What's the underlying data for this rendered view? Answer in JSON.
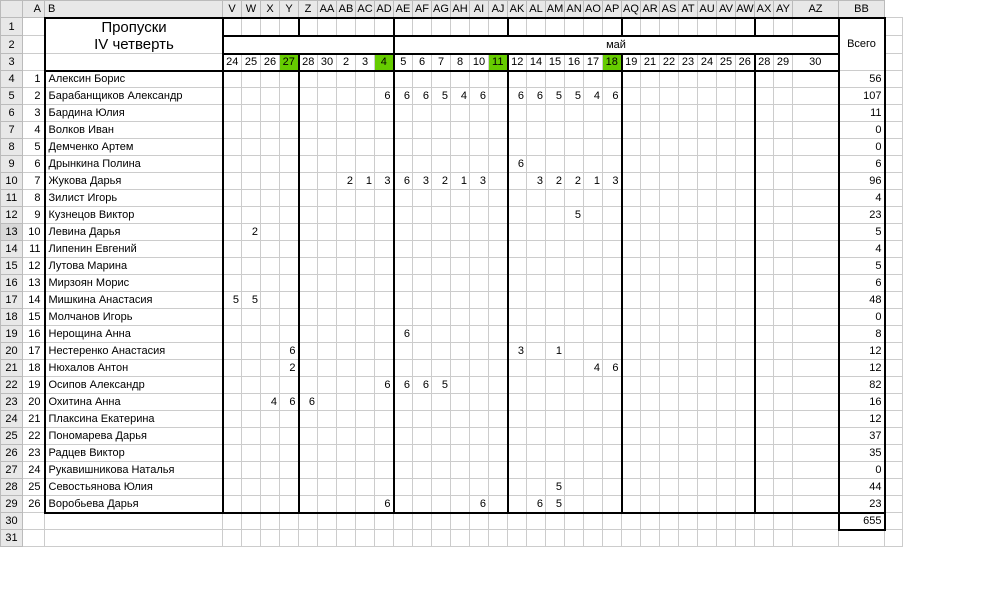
{
  "title_line1": "Пропуски",
  "title_line2": "IV четверть",
  "month_label": "май",
  "total_label": "Всего",
  "column_letters": [
    "A",
    "B",
    "V",
    "W",
    "X",
    "Y",
    "Z",
    "AA",
    "AB",
    "AC",
    "AD",
    "AE",
    "AF",
    "AG",
    "AH",
    "AI",
    "AJ",
    "AK",
    "AL",
    "AM",
    "AN",
    "AO",
    "AP",
    "AQ",
    "AR",
    "AS",
    "AT",
    "AU",
    "AV",
    "AW",
    "AX",
    "AY",
    "AZ",
    "BB"
  ],
  "row_numbers": [
    "1",
    "2",
    "3",
    "4",
    "5",
    "6",
    "7",
    "8",
    "9",
    "10",
    "11",
    "12",
    "13",
    "14",
    "15",
    "16",
    "17",
    "18",
    "19",
    "20",
    "21",
    "22",
    "23",
    "24",
    "25",
    "26",
    "27",
    "28",
    "29",
    "30",
    "31"
  ],
  "day_headers": [
    "24",
    "25",
    "26",
    "27",
    "28",
    "30",
    "2",
    "3",
    "4",
    "5",
    "6",
    "7",
    "8",
    "10",
    "11",
    "12",
    "14",
    "15",
    "16",
    "17",
    "18",
    "19",
    "21",
    "22",
    "23",
    "24",
    "25",
    "26",
    "28",
    "29",
    "30"
  ],
  "green_day_indices": [
    3,
    8,
    14,
    20
  ],
  "thick_before_indices": [
    4,
    9,
    15,
    21,
    28
  ],
  "students": [
    {
      "n": "1",
      "name": "Алексин Борис",
      "cells": {},
      "total": "56"
    },
    {
      "n": "2",
      "name": "Барабанщиков Александр",
      "cells": {
        "8": "6",
        "9": "6",
        "10": "6",
        "11": "5",
        "12": "4",
        "13": "6",
        "15": "6",
        "16": "6",
        "17": "5",
        "18": "5",
        "19": "4",
        "20": "6"
      },
      "total": "107"
    },
    {
      "n": "3",
      "name": "Бардина Юлия",
      "cells": {},
      "total": "11"
    },
    {
      "n": "4",
      "name": "Волков Иван",
      "cells": {},
      "total": "0"
    },
    {
      "n": "5",
      "name": "Демченко Артем",
      "cells": {},
      "total": "0"
    },
    {
      "n": "6",
      "name": "Дрынкина Полина",
      "cells": {
        "15": "6"
      },
      "total": "6"
    },
    {
      "n": "7",
      "name": "Жукова Дарья",
      "cells": {
        "6": "2",
        "7": "1",
        "8": "3",
        "9": "6",
        "10": "3",
        "11": "2",
        "12": "1",
        "13": "3",
        "16": "3",
        "17": "2",
        "18": "2",
        "19": "1",
        "20": "3"
      },
      "total": "96"
    },
    {
      "n": "8",
      "name": "Зилист Игорь",
      "cells": {},
      "total": "4"
    },
    {
      "n": "9",
      "name": "Кузнецов Виктор",
      "cells": {
        "18": "5"
      },
      "total": "23"
    },
    {
      "n": "10",
      "name": "Левина Дарья",
      "cells": {
        "1": "2"
      },
      "total": "5"
    },
    {
      "n": "11",
      "name": "Липенин Евгений",
      "cells": {},
      "total": "4"
    },
    {
      "n": "12",
      "name": "Лутова Марина",
      "cells": {},
      "total": "5"
    },
    {
      "n": "13",
      "name": "Мирзоян Морис",
      "cells": {},
      "total": "6"
    },
    {
      "n": "14",
      "name": "Мишкина Анастасия",
      "cells": {
        "0": "5",
        "1": "5"
      },
      "total": "48"
    },
    {
      "n": "15",
      "name": "Молчанов Игорь",
      "cells": {},
      "total": "0"
    },
    {
      "n": "16",
      "name": "Нерощина Анна",
      "cells": {
        "9": "6"
      },
      "total": "8"
    },
    {
      "n": "17",
      "name": "Нестеренко Анастасия",
      "cells": {
        "3": "6",
        "15": "3",
        "17": "1"
      },
      "total": "12"
    },
    {
      "n": "18",
      "name": "Нюхалов Антон",
      "cells": {
        "3": "2",
        "19": "4",
        "20": "6"
      },
      "total": "12"
    },
    {
      "n": "19",
      "name": "Осипов Александр",
      "cells": {
        "8": "6",
        "9": "6",
        "10": "6",
        "11": "5"
      },
      "total": "82"
    },
    {
      "n": "20",
      "name": "Охитина Анна",
      "cells": {
        "2": "4",
        "3": "6",
        "4": "6"
      },
      "total": "16"
    },
    {
      "n": "21",
      "name": "Плаксина Екатерина",
      "cells": {},
      "total": "12"
    },
    {
      "n": "22",
      "name": "Пономарева Дарья",
      "cells": {},
      "total": "37"
    },
    {
      "n": "23",
      "name": "Радцев Виктор",
      "cells": {},
      "total": "35"
    },
    {
      "n": "24",
      "name": "Рукавишникова Наталья",
      "cells": {},
      "total": "0"
    },
    {
      "n": "25",
      "name": "Севостьянова Юлия",
      "cells": {
        "17": "5"
      },
      "total": "44"
    },
    {
      "n": "26",
      "name": "Воробьева Дарья",
      "cells": {
        "8": "6",
        "13": "6",
        "16": "6",
        "17": "5"
      },
      "total": "23"
    }
  ],
  "grand_total": "655"
}
